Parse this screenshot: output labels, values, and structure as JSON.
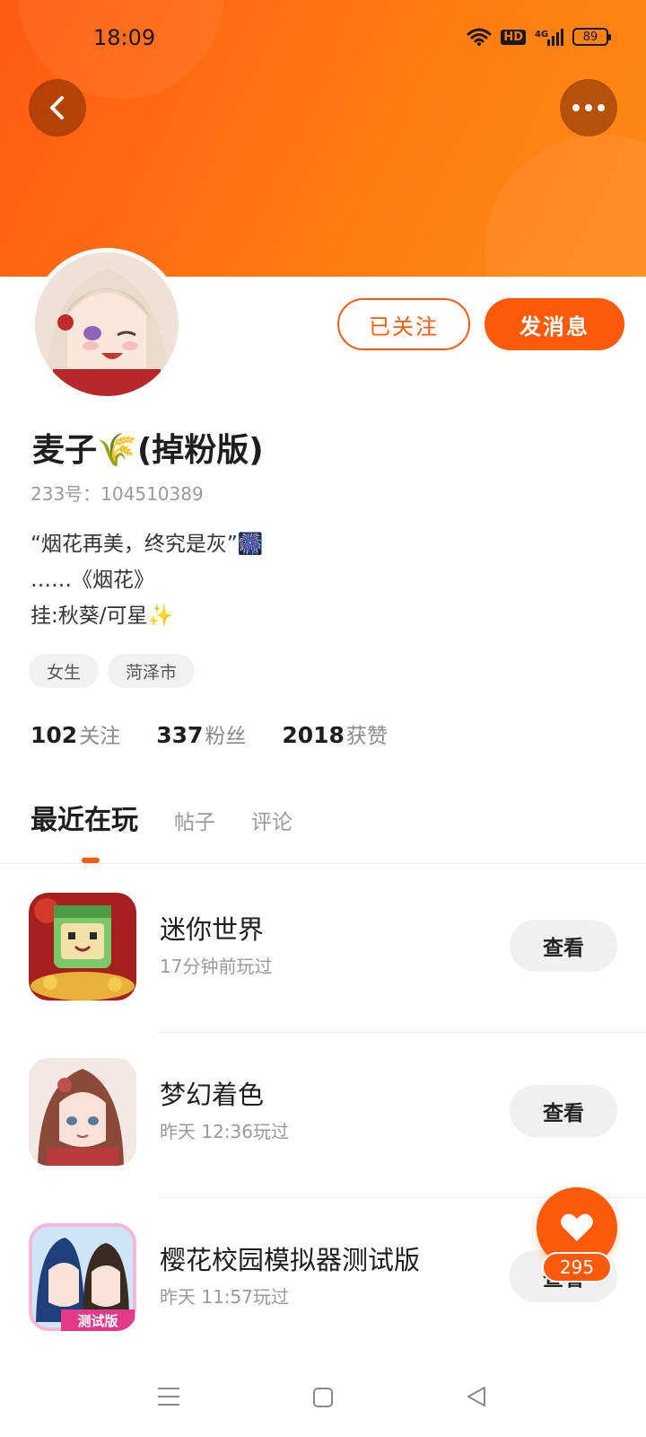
{
  "status_bar": {
    "time": "18:09",
    "hd_label": "HD",
    "network": "4G",
    "battery": "89"
  },
  "header": {
    "accent_color": "#ff6a10",
    "back_icon": "chevron-left-icon",
    "more_icon": "more-horizontal-icon"
  },
  "profile": {
    "name": "麦子🌾(掉粉版)",
    "id_line": "233号：104510389",
    "bio_lines": [
      "“烟花再美，终究是灰”🎆",
      "……《烟花》",
      "挂:秋葵/可星✨"
    ],
    "tags": [
      "女生",
      "菏泽市"
    ],
    "stats": [
      {
        "num": "102",
        "label": "关注"
      },
      {
        "num": "337",
        "label": "粉丝"
      },
      {
        "num": "2018",
        "label": "获赞"
      }
    ],
    "followed_label": "已关注",
    "message_label": "发消息"
  },
  "tabs": [
    {
      "label": "最近在玩",
      "active": true
    },
    {
      "label": "帖子",
      "active": false
    },
    {
      "label": "评论",
      "active": false
    }
  ],
  "games": [
    {
      "name": "迷你世界",
      "time": "17分钟前玩过",
      "button": "查看"
    },
    {
      "name": "梦幻着色",
      "time": "昨天 12:36玩过",
      "button": "查看"
    },
    {
      "name": "樱花校园模拟器测试版",
      "time": "昨天 11:57玩过",
      "button": "查看",
      "icon_caption": "测试版"
    }
  ],
  "like_fab": {
    "count": "295",
    "icon": "heart-icon"
  },
  "nav_bar": {
    "menu_icon": "menu-icon",
    "home_icon": "square-home-icon",
    "back_icon": "triangle-back-icon"
  }
}
